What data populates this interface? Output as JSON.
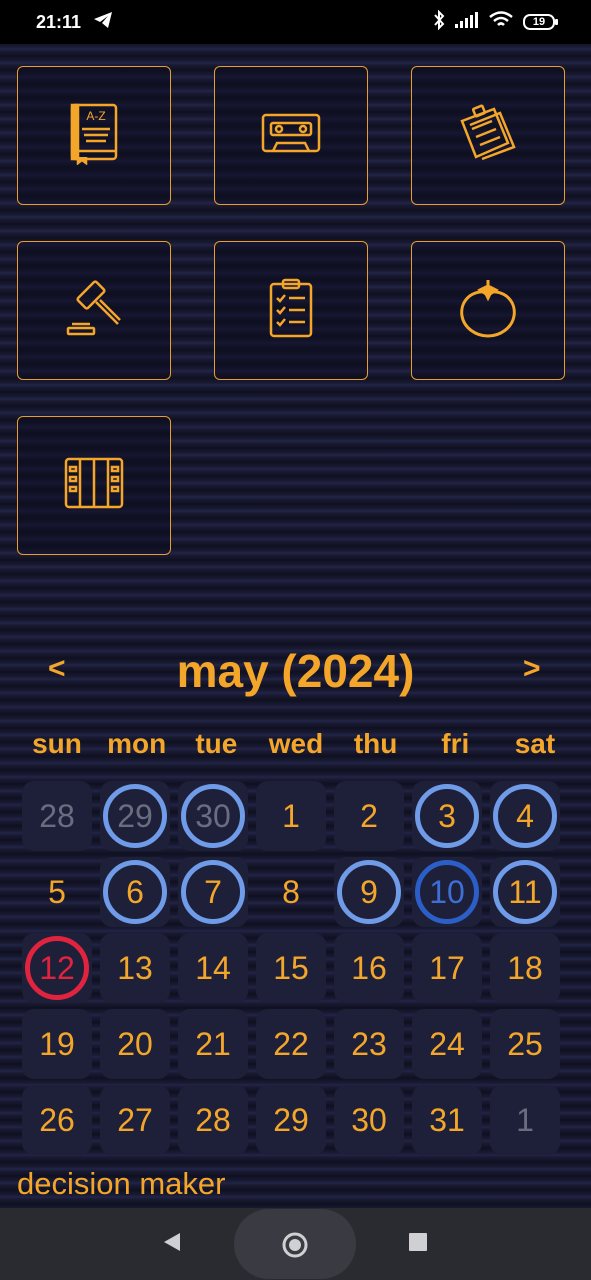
{
  "status": {
    "time": "21:11",
    "battery": "19"
  },
  "tiles": [
    {
      "icon": "dictionary-book-icon",
      "label": "A-Z"
    },
    {
      "icon": "cassette-tape-icon"
    },
    {
      "icon": "notes-papers-icon"
    },
    {
      "icon": "gavel-icon"
    },
    {
      "icon": "checklist-clipboard-icon"
    },
    {
      "icon": "tomato-icon"
    },
    {
      "icon": "lockers-icon"
    }
  ],
  "calendar": {
    "prev": "<",
    "next": ">",
    "title": "may (2024)",
    "weekdays": [
      "sun",
      "mon",
      "tue",
      "wed",
      "thu",
      "fri",
      "sat"
    ],
    "days": [
      {
        "d": "28",
        "muted": true,
        "ring": "none"
      },
      {
        "d": "29",
        "muted": true,
        "ring": "light"
      },
      {
        "d": "30",
        "muted": true,
        "ring": "light"
      },
      {
        "d": "1",
        "ring": "none"
      },
      {
        "d": "2",
        "ring": "none"
      },
      {
        "d": "3",
        "ring": "light"
      },
      {
        "d": "4",
        "ring": "light"
      },
      {
        "d": "5",
        "ring": "none",
        "nobg": true
      },
      {
        "d": "6",
        "ring": "light"
      },
      {
        "d": "7",
        "ring": "light"
      },
      {
        "d": "8",
        "ring": "none",
        "nobg": true
      },
      {
        "d": "9",
        "ring": "light"
      },
      {
        "d": "10",
        "ring": "dark"
      },
      {
        "d": "11",
        "ring": "light"
      },
      {
        "d": "12",
        "ring": "red"
      },
      {
        "d": "13",
        "ring": "none"
      },
      {
        "d": "14",
        "ring": "none"
      },
      {
        "d": "15",
        "ring": "none"
      },
      {
        "d": "16",
        "ring": "none"
      },
      {
        "d": "17",
        "ring": "none"
      },
      {
        "d": "18",
        "ring": "none"
      },
      {
        "d": "19",
        "ring": "none"
      },
      {
        "d": "20",
        "ring": "none"
      },
      {
        "d": "21",
        "ring": "none"
      },
      {
        "d": "22",
        "ring": "none"
      },
      {
        "d": "23",
        "ring": "none"
      },
      {
        "d": "24",
        "ring": "none"
      },
      {
        "d": "25",
        "ring": "none"
      },
      {
        "d": "26",
        "ring": "none"
      },
      {
        "d": "27",
        "ring": "none"
      },
      {
        "d": "28",
        "ring": "none"
      },
      {
        "d": "29",
        "ring": "none"
      },
      {
        "d": "30",
        "ring": "none"
      },
      {
        "d": "31",
        "ring": "none"
      },
      {
        "d": "1",
        "muted": true,
        "ring": "none"
      }
    ]
  },
  "footer_label": "decision maker",
  "colors": {
    "accent": "#f4a62a",
    "ring_light": "#6f9be8",
    "ring_dark": "#2c5ec8",
    "ring_today": "#e0243f",
    "cell_bg": "#1d2038"
  },
  "navbar": {
    "back_icon": "back-triangle-icon",
    "home_icon": "home-circle-icon",
    "recents_icon": "recents-square-icon"
  }
}
